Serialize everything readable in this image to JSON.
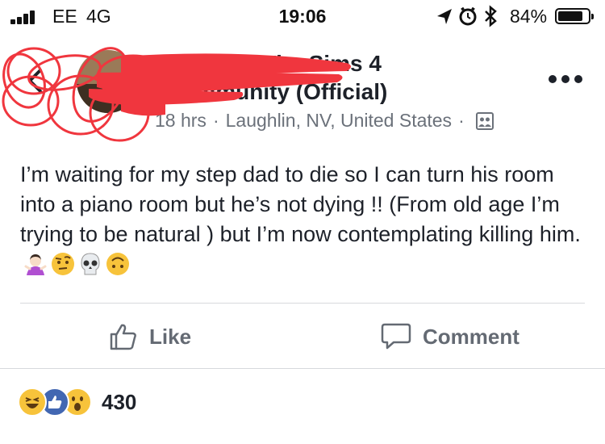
{
  "status_bar": {
    "carrier": "EE",
    "network": "4G",
    "time": "19:06",
    "battery_percent": "84%",
    "battery_level": 0.84,
    "icons": [
      "location-arrow-icon",
      "alarm-clock-icon",
      "bluetooth-icon"
    ]
  },
  "post": {
    "group_name_line1": "The Sims 4",
    "group_name_line2": "Community (Official)",
    "time_ago": "18 hrs",
    "location": "Laughlin, NV, United States",
    "separator": "·",
    "text": "I’m waiting for my step dad to die so I can turn his room into a piano room but he’s not dying !! (From old age I’m trying to be natural ) but I’m now contemplating killing him.",
    "emojis": [
      "woman-shrugging-icon",
      "face-raised-eyebrow-icon",
      "skull-icon",
      "upside-down-face-icon"
    ]
  },
  "actions": {
    "like_label": "Like",
    "comment_label": "Comment"
  },
  "reactions": {
    "icons": [
      "haha-reaction-icon",
      "like-reaction-icon",
      "wow-reaction-icon"
    ],
    "count": "430"
  },
  "colors": {
    "text": "#1d2129",
    "secondary": "#646a73",
    "like_blue": "#4267b2",
    "reaction_yellow": "#f7c33b",
    "scribble_red": "#f0363e"
  }
}
